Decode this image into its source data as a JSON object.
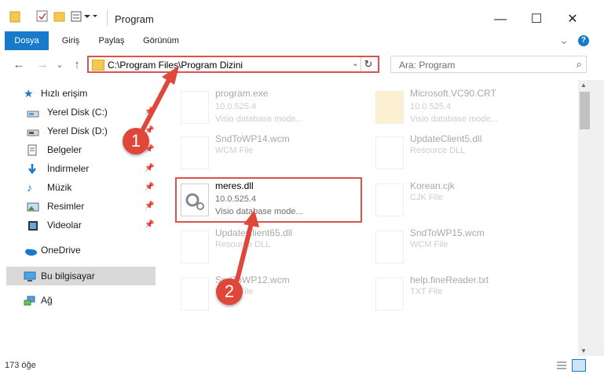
{
  "window": {
    "title": "Program",
    "minimize": "—",
    "maximize": "☐",
    "close": "✕"
  },
  "ribbon": {
    "tabs": [
      {
        "label": "Dosya",
        "active": true
      },
      {
        "label": "Giriş"
      },
      {
        "label": "Paylaş"
      },
      {
        "label": "Görünüm"
      }
    ],
    "expand": "⌄",
    "help": "?"
  },
  "nav": {
    "back": "←",
    "forward": "→",
    "recent": "⌄",
    "up": "↑"
  },
  "address": {
    "path": "C:\\Program Files\\Program Dizini",
    "dropdown": "⌄",
    "refresh": "↻"
  },
  "search": {
    "placeholder": "Ara: Program",
    "icon": "⌕"
  },
  "sidebar": {
    "items": [
      {
        "label": "Hızlı erişim",
        "icon": "star-icon"
      },
      {
        "label": "Yerel Disk (C:)",
        "icon": "drive-icon",
        "pinned": true
      },
      {
        "label": "Yerel Disk (D:)",
        "icon": "drive-icon",
        "pinned": true
      },
      {
        "label": "Belgeler",
        "icon": "documents-icon",
        "pinned": true
      },
      {
        "label": "İndirmeler",
        "icon": "download-icon",
        "pinned": true
      },
      {
        "label": "Müzik",
        "icon": "music-icon",
        "pinned": true
      },
      {
        "label": "Resimler",
        "icon": "pictures-icon",
        "pinned": true
      },
      {
        "label": "Videolar",
        "icon": "videos-icon",
        "pinned": true
      },
      {
        "label": "OneDrive",
        "icon": "cloud-icon"
      },
      {
        "label": "Bu bilgisayar",
        "icon": "computer-icon",
        "selected": true
      },
      {
        "label": "Ağ",
        "icon": "network-icon"
      }
    ]
  },
  "files": [
    {
      "name": "program.exe",
      "version": "10.0.525.4",
      "type": "Visio database mode..."
    },
    {
      "name": "Microsoft.VC90.CRT",
      "version": "10.0.525.4",
      "type": "Visio database mode..."
    },
    {
      "name": "SndToWP14.wcm",
      "version": "",
      "type": "WCM File"
    },
    {
      "name": "UpdateClient5.dll",
      "version": "",
      "type": "Resource DLL"
    },
    {
      "name": "meres.dll",
      "version": "10.0.525.4",
      "type": "Visio database mode..."
    },
    {
      "name": "Korean.cjk",
      "version": "",
      "type": "CJK File"
    },
    {
      "name": "UpdateClient65.dll",
      "version": "",
      "type": "Resource DLL"
    },
    {
      "name": "SndToWP15.wcm",
      "version": "",
      "type": "WCM File"
    },
    {
      "name": "SndToWP12.wcm",
      "version": "",
      "type": "WCM File"
    },
    {
      "name": "help.fineReader.txt",
      "version": "",
      "type": "TXT File"
    }
  ],
  "status": {
    "count": "173 öğe"
  },
  "annotations": {
    "step1": "1",
    "step2": "2"
  },
  "colors": {
    "accent": "#1979ca",
    "highlight": "#d9534f"
  }
}
